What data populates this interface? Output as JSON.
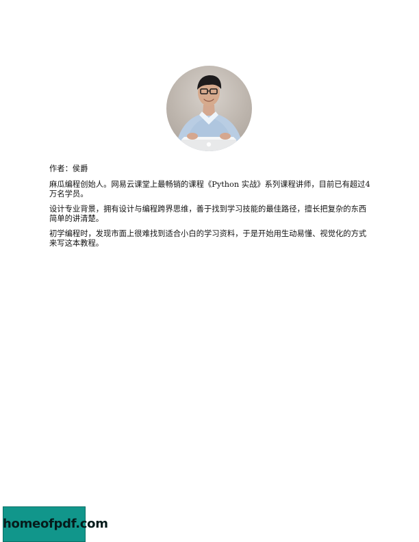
{
  "author": {
    "label": "作者：侯爵"
  },
  "bio": {
    "paragraph_1": "麻瓜编程创始人。网易云课堂上最畅销的课程《Python 实战》系列课程讲师，目前已有超过4万名学员。",
    "paragraph_2": "设计专业背景，拥有设计与编程跨界思维，善于找到学习技能的最佳路径，擅长把复杂的东西简单的讲清楚。",
    "paragraph_3": "初学编程时，发现市面上很难找到适合小白的学习资料，于是开始用生动易懂、视觉化的方式来写这本教程。"
  },
  "watermark": {
    "text": "homeofpdf.com"
  },
  "colors": {
    "watermark_bg": "#11968b",
    "text": "#111111"
  }
}
